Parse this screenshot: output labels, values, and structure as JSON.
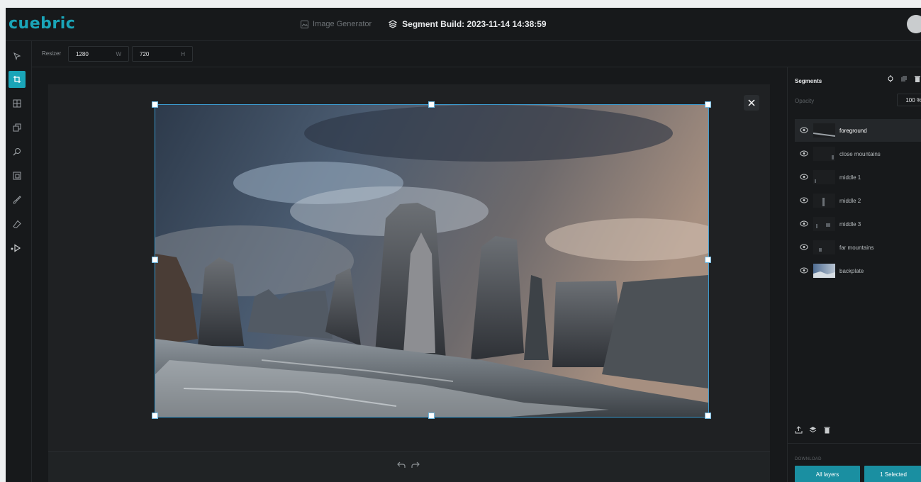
{
  "header": {
    "logo": "cuebric",
    "image_generator": "Image Generator",
    "build_label": "Segment Build: 2023-11-14 14:38:59"
  },
  "resizer": {
    "label": "Resizer",
    "width_value": "1280",
    "width_unit": "W",
    "height_value": "720",
    "height_unit": "H"
  },
  "toolbar": {
    "tools": [
      "select-tool",
      "crop-tool",
      "image-tool",
      "layers-tool",
      "magic-tool",
      "segment-tool",
      "brush-tool",
      "eraser-tool",
      "play-tool"
    ]
  },
  "segments_panel": {
    "title": "Segments",
    "opacity_label": "Opacity",
    "opacity_value": "100 %",
    "layers": [
      {
        "name": "foreground",
        "selected": true
      },
      {
        "name": "close mountains",
        "selected": false
      },
      {
        "name": "middle 1",
        "selected": false
      },
      {
        "name": "middle 2",
        "selected": false
      },
      {
        "name": "middle 3",
        "selected": false
      },
      {
        "name": "far mountains",
        "selected": false
      },
      {
        "name": "backplate",
        "selected": false
      }
    ],
    "download_label": "DOWNLOAD",
    "all_layers_button": "All layers",
    "selected_button": "1 Selected"
  },
  "colors": {
    "accent": "#1aa5b8",
    "background": "#17191b"
  }
}
